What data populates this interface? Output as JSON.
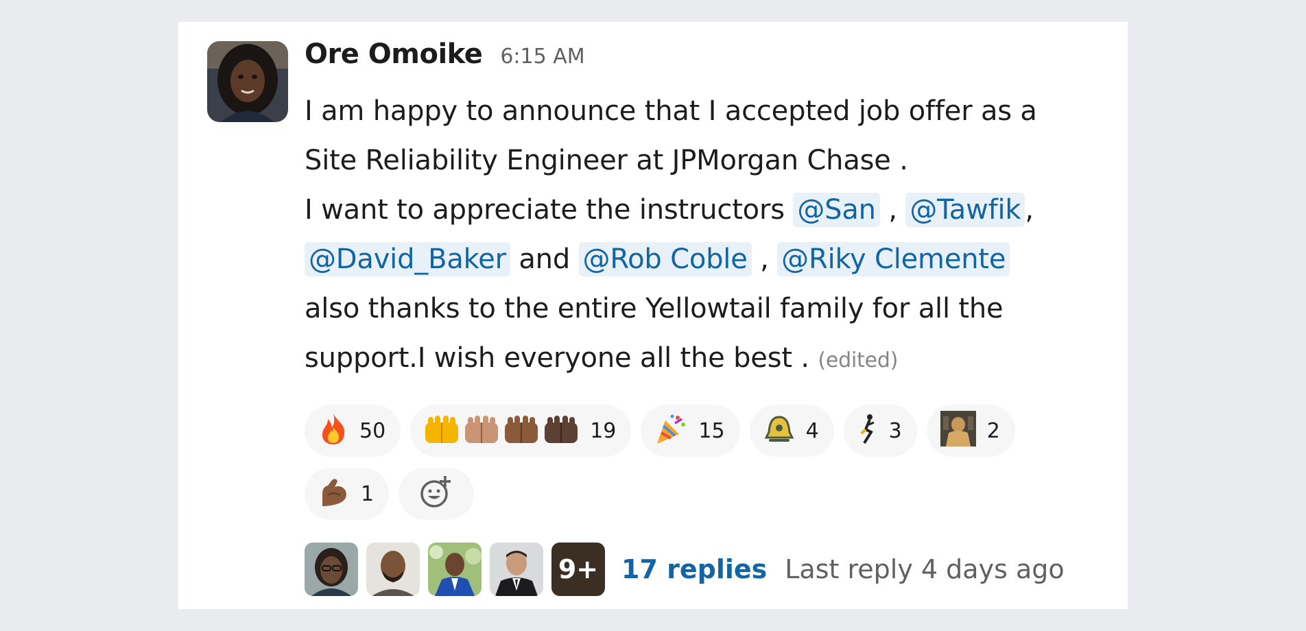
{
  "message": {
    "author": "Ore Omoike",
    "time": "6:15 AM",
    "text_line1": "I am happy to announce that I accepted job offer as a",
    "text_line2": "Site Reliability Engineer at JPMorgan Chase .",
    "text_line3_prefix": "I want to appreciate the instructors ",
    "text_comma_1": " , ",
    "text_comma_2": ",",
    "text_and": " and ",
    "text_comma_3": " , ",
    "text_line5": "also thanks to the entire Yellowtail family for all the",
    "text_line6": "support.I wish everyone all the best . ",
    "edited": "(edited)",
    "mentions": [
      "@San",
      "@Tawfik",
      "@David_Baker",
      "@Rob Coble",
      "@Riky Clemente"
    ]
  },
  "reactions": [
    {
      "icon": "fire-icon",
      "count": "50"
    },
    {
      "icon": "raised-hands-multi-skin-icon",
      "count": "19"
    },
    {
      "icon": "party-popper-icon",
      "count": "15"
    },
    {
      "icon": "bell-icon",
      "count": "4"
    },
    {
      "icon": "dancer-icon",
      "count": "3"
    },
    {
      "icon": "custom-image-icon",
      "count": "2"
    },
    {
      "icon": "flexed-biceps-icon",
      "count": "1"
    }
  ],
  "thread": {
    "more_count": "9+",
    "replies": "17 replies",
    "last_reply": "Last reply 4 days ago"
  },
  "colors": {
    "background": "#e9ebef",
    "card": "#ffffff",
    "mention_text": "#1264a3",
    "mention_bg": "#e8f1f8",
    "reaction_bg": "#f6f6f6",
    "muted": "#616061"
  }
}
